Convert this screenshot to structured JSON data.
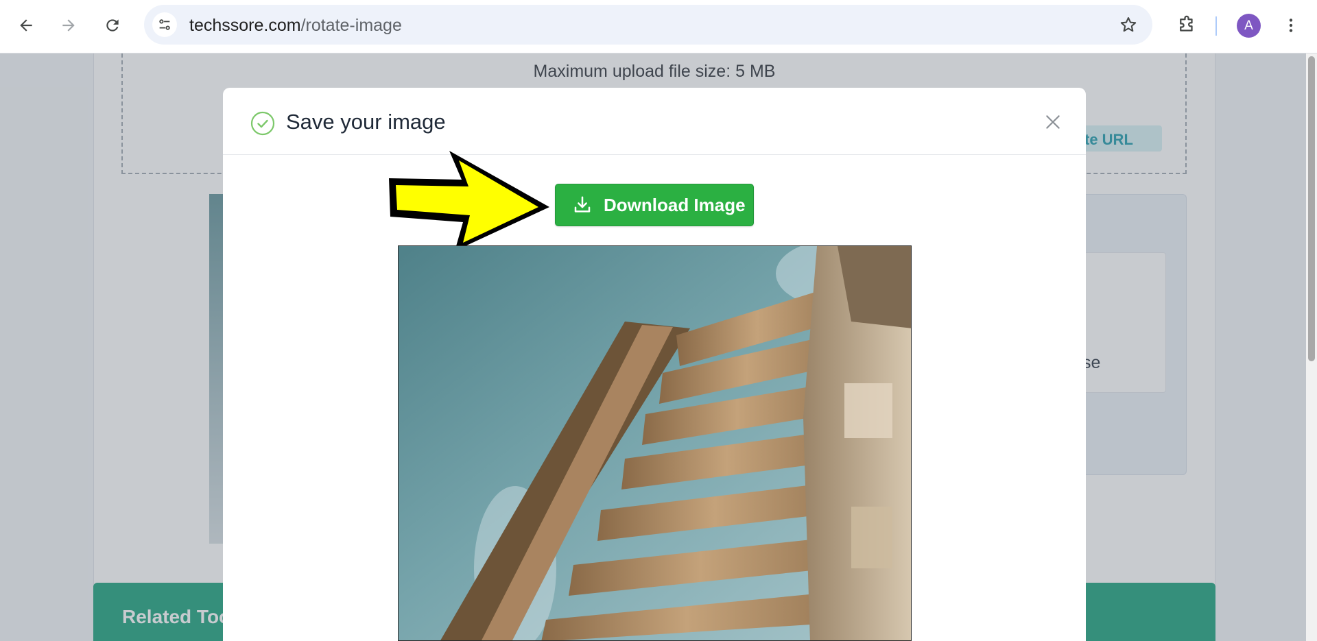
{
  "browser": {
    "url_domain": "techssore.com",
    "url_path": "/rotate-image",
    "profile_initial": "A"
  },
  "page": {
    "max_upload_text": "Maximum upload file size: 5 MB",
    "remote_url_label_partial": "mote URL",
    "options_text_partial": "se",
    "related_title_partial": "Related Too"
  },
  "modal": {
    "title": "Save your image",
    "download_label": "Download Image"
  },
  "colors": {
    "download_button": "#2bb042",
    "check_icon": "#7cc86a",
    "arrow_fill": "#ffff00",
    "related_bar": "#129f78",
    "remote_url_text": "#1497a8"
  },
  "icons": [
    "back-icon",
    "forward-icon",
    "reload-icon",
    "site-info-icon",
    "bookmark-star-icon",
    "extensions-icon",
    "more-menu-icon",
    "check-circle-icon",
    "close-icon",
    "download-icon",
    "pointer-arrow-icon"
  ]
}
